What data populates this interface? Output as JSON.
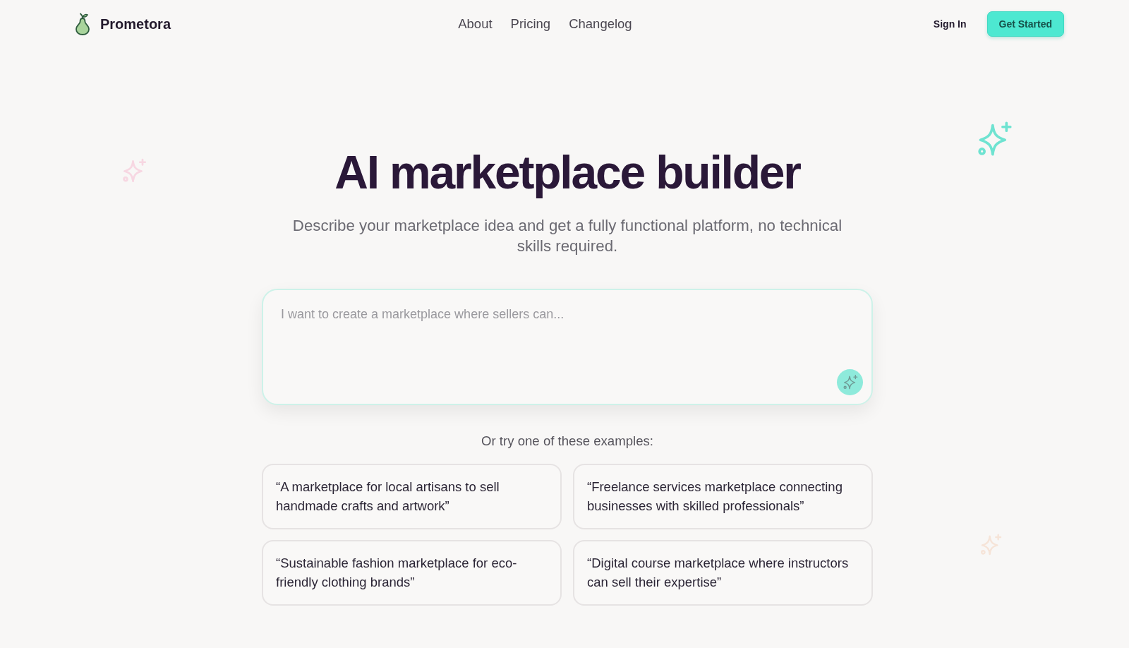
{
  "header": {
    "brand": "Prometora",
    "nav": [
      "About",
      "Pricing",
      "Changelog"
    ],
    "sign_in": "Sign In",
    "cta": "Get Started"
  },
  "hero": {
    "title": "AI marketplace builder",
    "subtitle": "Describe your marketplace idea and get a fully functional platform, no technical skills required."
  },
  "prompt": {
    "placeholder": "I want to create a marketplace where sellers can..."
  },
  "examples": {
    "heading": "Or try one of these examples:",
    "items": [
      "“A marketplace for local artisans to sell handmade crafts and artwork”",
      "“Freelance services marketplace connecting businesses with skilled professionals”",
      "“Sustainable fashion marketplace for eco-friendly clothing brands”",
      "“Digital course marketplace where instructors can sell their expertise”"
    ]
  }
}
